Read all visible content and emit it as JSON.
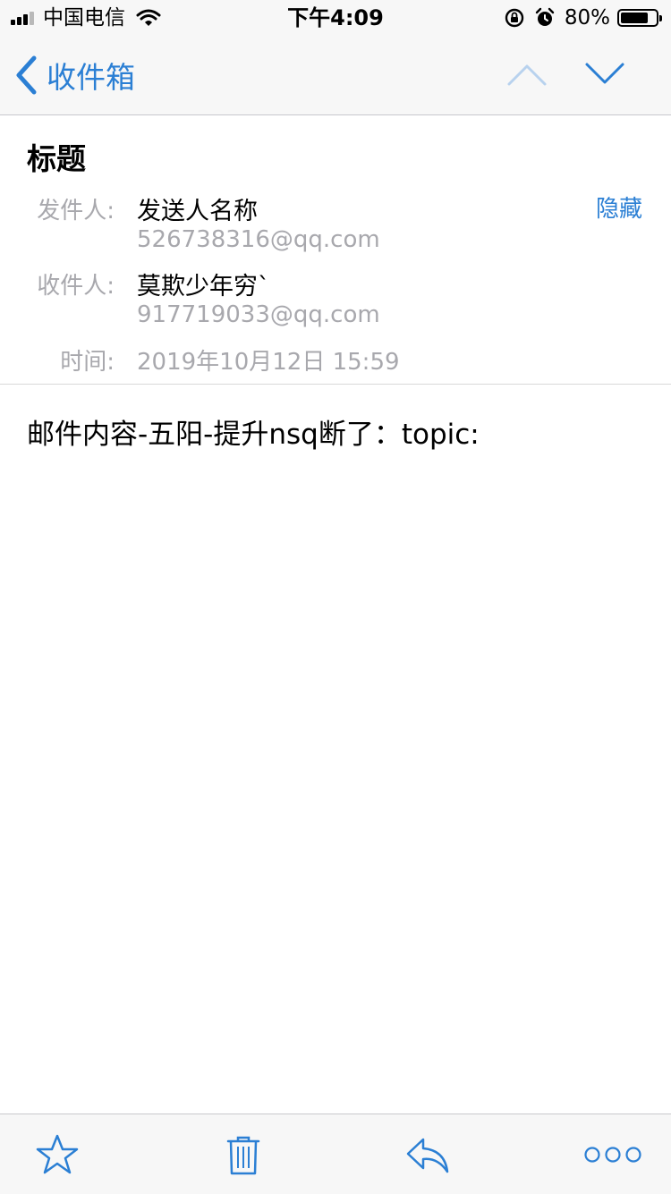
{
  "status_bar": {
    "carrier": "中国电信",
    "time": "下午4:09",
    "battery_percent": "80%",
    "battery_level": 0.8,
    "icons": [
      "signal-icon",
      "wifi-icon",
      "orientation-lock-icon",
      "alarm-icon",
      "battery-icon"
    ]
  },
  "nav": {
    "back_label": "收件箱",
    "icons": [
      "chevron-left-icon",
      "chevron-up-icon",
      "chevron-down-icon"
    ]
  },
  "mail": {
    "subject": "标题",
    "from_label": "发件人:",
    "from_name": "发送人名称",
    "from_email": "526738316@qq.com",
    "hide_label": "隐藏",
    "to_label": "收件人:",
    "to_name": "莫欺少年穷`",
    "to_email": "917719033@qq.com",
    "time_label": "时间:",
    "time_value": "2019年10月12日 15:59",
    "body": "邮件内容-五阳-提升nsq断了：topic:"
  },
  "toolbar": {
    "icons": [
      "star-icon",
      "trash-icon",
      "reply-icon",
      "more-icon"
    ]
  },
  "colors": {
    "accent": "#2b7fd4",
    "secondary_text": "#a8a8ad",
    "bar_background": "#f7f7f7"
  }
}
